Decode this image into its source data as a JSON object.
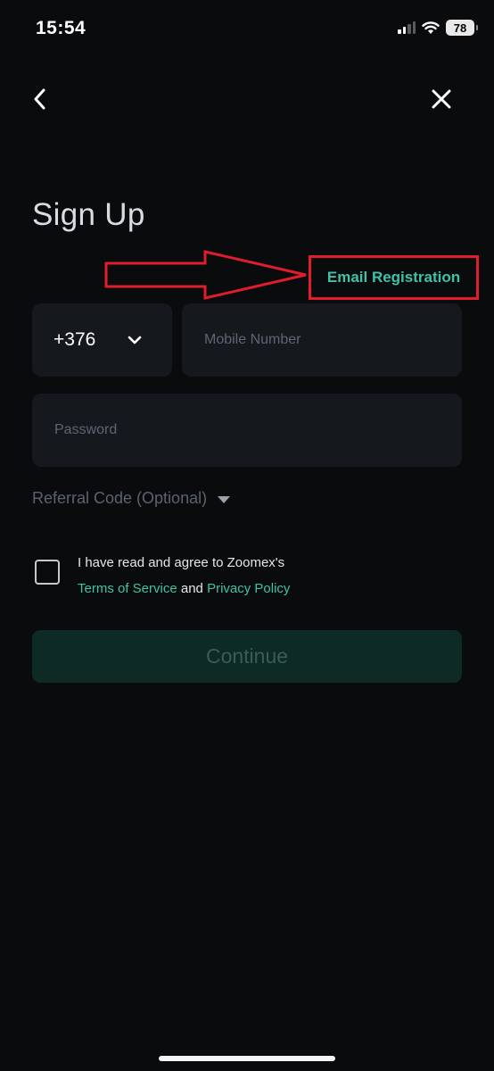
{
  "status_bar": {
    "time": "15:54",
    "battery": "78"
  },
  "header": {
    "title": "Sign Up",
    "email_registration": "Email Registration"
  },
  "form": {
    "country_code": "+376",
    "mobile_placeholder": "Mobile Number",
    "password_placeholder": "Password",
    "referral_label": "Referral Code (Optional)"
  },
  "agreement": {
    "line1": "I have read and agree to Zoomex's",
    "terms": "Terms of Service",
    "and": " and ",
    "privacy": "Privacy Policy"
  },
  "continue_label": "Continue",
  "colors": {
    "accent": "#3fc2a5",
    "annotation": "#e11d2a",
    "background": "#0a0b0d",
    "field": "#15181d"
  },
  "icons": [
    "back-arrow-icon",
    "close-icon",
    "chevron-down-icon",
    "caret-down-icon",
    "signal-icon",
    "wifi-icon",
    "battery-icon"
  ]
}
